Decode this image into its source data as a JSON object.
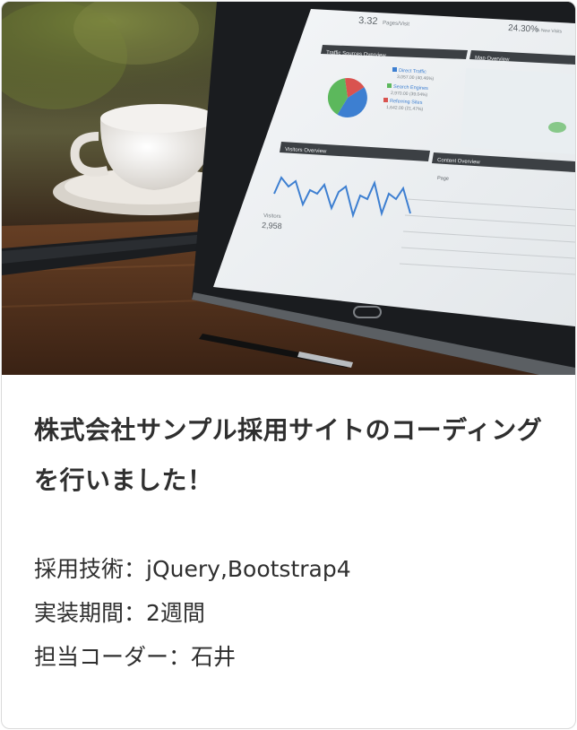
{
  "card": {
    "title": "株式会社サンプル採用サイトのコーディングを行いました！",
    "details": [
      {
        "label": "採用技術：",
        "value": "jQuery,Bootstrap4"
      },
      {
        "label": "実装期間：",
        "value": "2週間"
      },
      {
        "label": "担当コーダー：",
        "value": "石井"
      }
    ]
  },
  "screen": {
    "top_value": "3.32",
    "top_caption": "Pages/Visit",
    "top_right_value": "24.30%",
    "top_right_caption": "% New Visits",
    "traffic_panel_title": "Traffic Sources Overview",
    "map_panel_title": "Map Overview",
    "visitors_panel_title": "Visitors Overview",
    "content_panel_title": "Content Overview",
    "legend": [
      {
        "label": "Direct Traffic",
        "value": "3,057.00 (40.46%)",
        "color": "#3d7fd1"
      },
      {
        "label": "Search Engines",
        "value": "2,970.00 (39.04%)",
        "color": "#5cb85c"
      },
      {
        "label": "Referring Sites",
        "value": "1,642.00 (21.47%)",
        "color": "#d9534f"
      }
    ],
    "visitors_label": "Visitors",
    "visitors_value": "2,958",
    "content_column": "Page"
  }
}
